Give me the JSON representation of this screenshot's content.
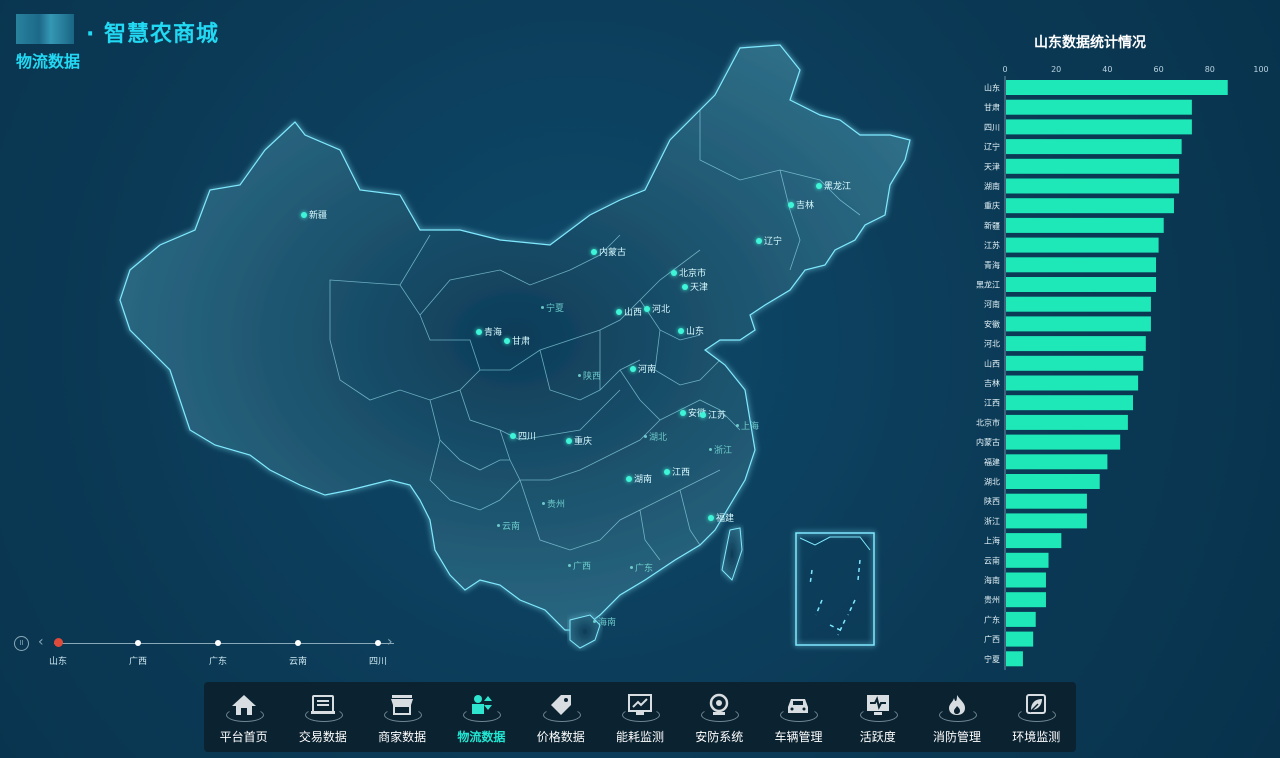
{
  "header": {
    "app_title": "· 智慧农商城",
    "page_subtitle": "物流数据"
  },
  "map": {
    "provinces": [
      {
        "name": "新疆",
        "style": "dot"
      },
      {
        "name": "内蒙古",
        "style": "dot"
      },
      {
        "name": "黑龙江",
        "style": "dot"
      },
      {
        "name": "吉林",
        "style": "dot"
      },
      {
        "name": "辽宁",
        "style": "dot"
      },
      {
        "name": "北京市",
        "style": "dot"
      },
      {
        "name": "天津",
        "style": "dot"
      },
      {
        "name": "河北",
        "style": "dot"
      },
      {
        "name": "山西",
        "style": "dot"
      },
      {
        "name": "山东",
        "style": "dot"
      },
      {
        "name": "宁夏",
        "style": "faint"
      },
      {
        "name": "青海",
        "style": "dot"
      },
      {
        "name": "甘肃",
        "style": "dot"
      },
      {
        "name": "陕西",
        "style": "faint"
      },
      {
        "name": "河南",
        "style": "dot"
      },
      {
        "name": "安徽",
        "style": "dot"
      },
      {
        "name": "江苏",
        "style": "dot"
      },
      {
        "name": "上海",
        "style": "faint"
      },
      {
        "name": "四川",
        "style": "dot"
      },
      {
        "name": "重庆",
        "style": "dot"
      },
      {
        "name": "湖北",
        "style": "faint"
      },
      {
        "name": "浙江",
        "style": "faint"
      },
      {
        "name": "湖南",
        "style": "dot"
      },
      {
        "name": "江西",
        "style": "dot"
      },
      {
        "name": "贵州",
        "style": "faint"
      },
      {
        "name": "福建",
        "style": "dot"
      },
      {
        "name": "云南",
        "style": "faint"
      },
      {
        "name": "广西",
        "style": "faint"
      },
      {
        "name": "广东",
        "style": "faint"
      },
      {
        "name": "海南",
        "style": "faint"
      }
    ]
  },
  "chart_data": {
    "type": "bar",
    "orientation": "horizontal",
    "title": "山东数据统计情况",
    "xlim": [
      0,
      100
    ],
    "xticks": [
      0,
      20,
      40,
      60,
      80,
      100
    ],
    "categories": [
      "山东",
      "甘肃",
      "四川",
      "辽宁",
      "天津",
      "湖南",
      "重庆",
      "新疆",
      "江苏",
      "青海",
      "黑龙江",
      "河南",
      "安徽",
      "河北",
      "山西",
      "吉林",
      "江西",
      "北京市",
      "内蒙古",
      "福建",
      "湖北",
      "陕西",
      "浙江",
      "上海",
      "云南",
      "海南",
      "贵州",
      "广东",
      "广西",
      "宁夏"
    ],
    "values": [
      87,
      73,
      73,
      69,
      68,
      68,
      66,
      62,
      60,
      59,
      59,
      57,
      57,
      55,
      54,
      52,
      50,
      48,
      45,
      40,
      37,
      32,
      32,
      22,
      17,
      16,
      16,
      12,
      11,
      7
    ],
    "bar_color": "#1ee8b8"
  },
  "timeline": {
    "pause_icon": "pause-icon",
    "prev_icon": "chevron-left-icon",
    "next_icon": "chevron-right-icon",
    "active_index": 0,
    "items": [
      "山东",
      "广西",
      "广东",
      "云南",
      "四川"
    ]
  },
  "bottom_nav": {
    "active_index": 3,
    "items": [
      {
        "label": "平台首页",
        "icon": "home-icon"
      },
      {
        "label": "交易数据",
        "icon": "receipt-icon"
      },
      {
        "label": "商家数据",
        "icon": "store-icon"
      },
      {
        "label": "物流数据",
        "icon": "logistics-icon"
      },
      {
        "label": "价格数据",
        "icon": "price-tag-icon"
      },
      {
        "label": "能耗监测",
        "icon": "chart-monitor-icon"
      },
      {
        "label": "安防系统",
        "icon": "camera-icon"
      },
      {
        "label": "车辆管理",
        "icon": "car-icon"
      },
      {
        "label": "活跃度",
        "icon": "pulse-icon"
      },
      {
        "label": "消防管理",
        "icon": "fire-icon"
      },
      {
        "label": "环境监测",
        "icon": "leaf-icon"
      }
    ]
  }
}
